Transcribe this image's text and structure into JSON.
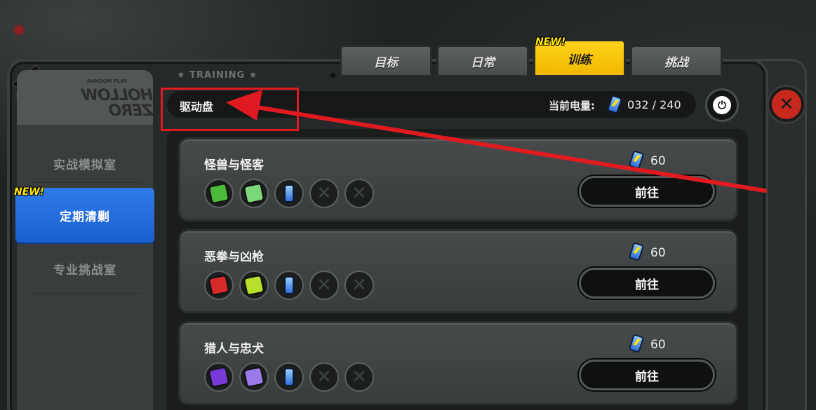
{
  "header": {
    "section_label": "★ TRAINING ★",
    "title": "驱动盘",
    "energy_label": "当前电量:",
    "energy_value": "032 / 240"
  },
  "tabs": [
    {
      "label": "目标",
      "active": false
    },
    {
      "label": "日常",
      "active": false
    },
    {
      "label": "训练",
      "active": true,
      "badge": "NEW!"
    },
    {
      "label": "挑战",
      "active": false
    }
  ],
  "sidebar": {
    "logo_small": "RANDOM PLAY",
    "logo_big": "HOLLOW ZERO",
    "items": [
      {
        "label": "实战模拟室",
        "active": false
      },
      {
        "label": "定期清剿",
        "active": true,
        "badge": "NEW!"
      },
      {
        "label": "专业挑战室",
        "active": false
      }
    ]
  },
  "cards": [
    {
      "title": "怪兽与怪客",
      "cost": "60",
      "go_label": "前往",
      "disc_colors": [
        "#4dbb3a",
        "#7ad87a"
      ]
    },
    {
      "title": "恶拳与凶枪",
      "cost": "60",
      "go_label": "前往",
      "disc_colors": [
        "#d62a2a",
        "#b8e02a"
      ]
    },
    {
      "title": "猎人与忠犬",
      "cost": "60",
      "go_label": "前往",
      "disc_colors": [
        "#7a3ad8",
        "#9a7ae8"
      ]
    }
  ],
  "colors": {
    "accent_yellow": "#ffd21a",
    "active_blue": "#2f7be8",
    "highlight_red": "#e11a22",
    "close_red": "#c8291e"
  },
  "icons": {
    "close": "close-icon",
    "power": "power-icon",
    "battery": "battery-icon"
  }
}
